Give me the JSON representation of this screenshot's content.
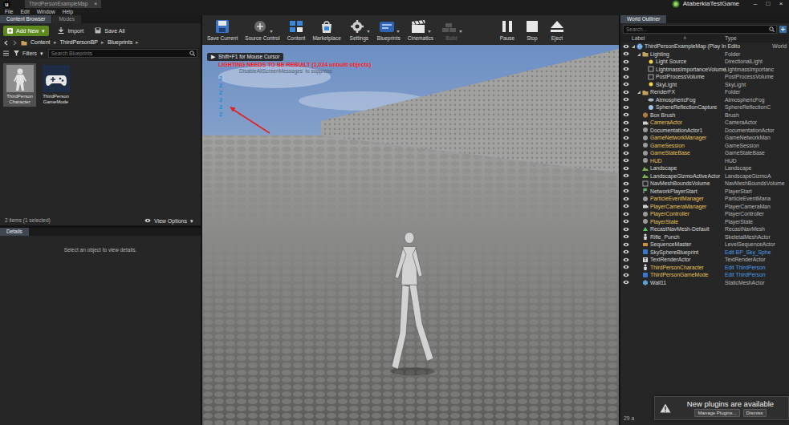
{
  "titlebar": {
    "logo": "u",
    "tab": {
      "label": "ThirdPersonExampleMap",
      "close": "×"
    },
    "project": "AtaberkiaTestGame",
    "controls": [
      "–",
      "□",
      "×"
    ]
  },
  "menu": [
    "File",
    "Edit",
    "Window",
    "Help"
  ],
  "content_browser": {
    "tabs": [
      {
        "label": "Content Browser",
        "selected": true
      },
      {
        "label": "Modes",
        "selected": false
      }
    ],
    "add_new": {
      "label": "Add New",
      "caret": "▾"
    },
    "import": "Import",
    "save_all": "Save All",
    "path": [
      "Content",
      "ThirdPersonBP",
      "Blueprints"
    ],
    "separator": "▸",
    "filters": {
      "label": "Filters",
      "caret": "▾"
    },
    "search": {
      "placeholder": "Search Blueprints"
    },
    "assets": [
      {
        "name": "ThirdPerson Character",
        "kind": "character",
        "selected": true
      },
      {
        "name": "ThirdPerson GameMode",
        "kind": "gamemode",
        "selected": false
      }
    ],
    "count": "2 items (1 selected)",
    "view_options": {
      "label": "View Options",
      "caret": "▾"
    }
  },
  "details": {
    "tab": {
      "label": "Details",
      "selected": true
    },
    "empty": "Select an object to view details."
  },
  "toolbar": [
    {
      "label": "Save Current",
      "kind": "save",
      "has_menu": false,
      "disabled": false
    },
    {
      "label": "Source Control",
      "kind": "source",
      "has_menu": true,
      "disabled": false
    },
    {
      "label": "Content",
      "kind": "content",
      "has_menu": false,
      "disabled": false
    },
    {
      "label": "Marketplace",
      "kind": "market",
      "has_menu": false,
      "disabled": false
    },
    {
      "label": "Settings",
      "kind": "settings",
      "has_menu": true,
      "disabled": false
    },
    {
      "label": "Blueprints",
      "kind": "blueprints",
      "has_menu": true,
      "disabled": false
    },
    {
      "label": "Cinematics",
      "kind": "cinematics",
      "has_menu": true,
      "disabled": false
    },
    {
      "label": "Build",
      "kind": "build",
      "has_menu": true,
      "disabled": true
    },
    {
      "label": "Pause",
      "kind": "pause",
      "has_menu": false,
      "disabled": false
    },
    {
      "label": "Stop",
      "kind": "stop",
      "has_menu": false,
      "disabled": false
    },
    {
      "label": "Eject",
      "kind": "eject",
      "has_menu": false,
      "disabled": false
    }
  ],
  "viewport": {
    "hint_icon": "▶",
    "hint": "Shift+F1 for Mouse Cursor",
    "warning": "LIGHTING NEEDS TO BE REBUILT (1,024 unbuilt objects)",
    "suppress": "DisableAllScreenMessages' to suppress",
    "messages": [
      "2",
      "2",
      "2",
      "2",
      "2",
      "2"
    ]
  },
  "outliner": {
    "tab": {
      "label": "World Outliner",
      "selected": true
    },
    "search": {
      "placeholder": "Search..."
    },
    "columns": {
      "label": "Label",
      "sort_icon": "˄",
      "type": "Type"
    },
    "rows": [
      {
        "label": "ThirdPersonExampleMap (Play In Edito",
        "type": "World",
        "depth": 0,
        "kind": "world",
        "expanded": true,
        "visible": true,
        "color": "#d8d8d8",
        "type_color": "#b8b8b8"
      },
      {
        "label": "Lighting",
        "type": "Folder",
        "depth": 1,
        "kind": "folder",
        "expanded": true,
        "visible": true,
        "color": "#d8d8d8",
        "type_color": "#b8b8b8"
      },
      {
        "label": "Light Source",
        "type": "DirectionalLight",
        "depth": 2,
        "kind": "light",
        "visible": true,
        "color": "#d8d8d8",
        "type_color": "#b8b8b8"
      },
      {
        "label": "LightmassImportanceVolume",
        "type": "LightmassImportanc",
        "depth": 2,
        "kind": "volume",
        "visible": true,
        "color": "#d8d8d8",
        "type_color": "#b8b8b8"
      },
      {
        "label": "PostProcessVolume",
        "type": "PostProcessVolume",
        "depth": 2,
        "kind": "volume",
        "visible": true,
        "color": "#d8d8d8",
        "type_color": "#b8b8b8"
      },
      {
        "label": "SkyLight",
        "type": "SkyLight",
        "depth": 2,
        "kind": "light",
        "visible": true,
        "color": "#d8d8d8",
        "type_color": "#b8b8b8"
      },
      {
        "label": "RenderFX",
        "type": "Folder",
        "depth": 1,
        "kind": "folder",
        "expanded": true,
        "visible": true,
        "color": "#d8d8d8",
        "type_color": "#b8b8b8"
      },
      {
        "label": "AtmosphericFog",
        "type": "AtmosphericFog",
        "depth": 2,
        "kind": "fog",
        "visible": true,
        "color": "#d8d8d8",
        "type_color": "#b8b8b8"
      },
      {
        "label": "SphereReflectionCapture",
        "type": "SphereReflectionC",
        "depth": 2,
        "kind": "capture",
        "visible": true,
        "color": "#d8d8d8",
        "type_color": "#b8b8b8"
      },
      {
        "label": "Box Brush",
        "type": "Brush",
        "depth": 1,
        "kind": "brush",
        "visible": true,
        "color": "#d8d8d8",
        "type_color": "#b8b8b8"
      },
      {
        "label": "CameraActor",
        "type": "CameraActor",
        "depth": 1,
        "kind": "camera",
        "visible": true,
        "color": "#e7c15e",
        "type_color": "#b8b8b8"
      },
      {
        "label": "DocumentationActor1",
        "type": "DocumentationActor",
        "depth": 1,
        "kind": "info",
        "visible": true,
        "color": "#d8d8d8",
        "type_color": "#b8b8b8"
      },
      {
        "label": "GameNetworkManager",
        "type": "GameNetworkMan",
        "depth": 1,
        "kind": "info",
        "visible": true,
        "color": "#e7c15e",
        "type_color": "#b8b8b8"
      },
      {
        "label": "GameSession",
        "type": "GameSession",
        "depth": 1,
        "kind": "info",
        "visible": true,
        "color": "#e7c15e",
        "type_color": "#b8b8b8"
      },
      {
        "label": "GameStateBase",
        "type": "GameStateBase",
        "depth": 1,
        "kind": "info",
        "visible": true,
        "color": "#e7c15e",
        "type_color": "#b8b8b8"
      },
      {
        "label": "HUD",
        "type": "HUD",
        "depth": 1,
        "kind": "info",
        "visible": true,
        "color": "#e7c15e",
        "type_color": "#b8b8b8"
      },
      {
        "label": "Landscape",
        "type": "Landscape",
        "depth": 1,
        "kind": "landscape",
        "visible": true,
        "color": "#d8d8d8",
        "type_color": "#b8b8b8"
      },
      {
        "label": "LandscapeGizmoActiveActor",
        "type": "LandscapeGizmoA",
        "depth": 1,
        "kind": "landscape",
        "visible": true,
        "color": "#d8d8d8",
        "type_color": "#b8b8b8"
      },
      {
        "label": "NavMeshBoundsVolume",
        "type": "NavMeshBoundsVolume",
        "depth": 1,
        "kind": "volume",
        "visible": true,
        "color": "#d8d8d8",
        "type_color": "#b8b8b8"
      },
      {
        "label": "NetworkPlayerStart",
        "type": "PlayerStart",
        "depth": 1,
        "kind": "start",
        "visible": true,
        "color": "#d8d8d8",
        "type_color": "#b8b8b8"
      },
      {
        "label": "ParticleEventManager",
        "type": "ParticleEventMana",
        "depth": 1,
        "kind": "info",
        "visible": true,
        "color": "#e7c15e",
        "type_color": "#b8b8b8"
      },
      {
        "label": "PlayerCameraManager",
        "type": "PlayerCameraMan",
        "depth": 1,
        "kind": "camera",
        "visible": true,
        "color": "#e7c15e",
        "type_color": "#b8b8b8"
      },
      {
        "label": "PlayerController",
        "type": "PlayerController",
        "depth": 1,
        "kind": "info",
        "visible": true,
        "color": "#e7c15e",
        "type_color": "#b8b8b8"
      },
      {
        "label": "PlayerState",
        "type": "PlayerState",
        "depth": 1,
        "kind": "info",
        "visible": true,
        "color": "#e7c15e",
        "type_color": "#b8b8b8"
      },
      {
        "label": "RecastNavMesh-Default",
        "type": "RecastNavMesh",
        "depth": 1,
        "kind": "nav",
        "visible": true,
        "color": "#d8d8d8",
        "type_color": "#b8b8b8"
      },
      {
        "label": "Rifle_Punch",
        "type": "SkeletalMeshActor",
        "depth": 1,
        "kind": "pawn",
        "visible": true,
        "color": "#d8d8d8",
        "type_color": "#b8b8b8"
      },
      {
        "label": "SequenceMaster",
        "type": "LevelSequenceActor",
        "depth": 1,
        "kind": "sequence",
        "visible": true,
        "color": "#d8d8d8",
        "type_color": "#b8b8b8"
      },
      {
        "label": "SkySphereBlueprint",
        "type": "Edit BP_Sky_Sphe",
        "depth": 1,
        "kind": "blueprint",
        "visible": true,
        "color": "#d8d8d8",
        "type_color": "#4d9de6"
      },
      {
        "label": "TextRenderActor",
        "type": "TextRenderActor",
        "depth": 1,
        "kind": "text",
        "visible": true,
        "color": "#d8d8d8",
        "type_color": "#b8b8b8"
      },
      {
        "label": "ThirdPersonCharacter",
        "type": "Edit ThirdPerson",
        "depth": 1,
        "kind": "pawn",
        "visible": true,
        "color": "#e7c15e",
        "type_color": "#4d9de6"
      },
      {
        "label": "ThirdPersonGameMode",
        "type": "Edit ThirdPerson",
        "depth": 1,
        "kind": "blueprint",
        "visible": true,
        "color": "#e7c15e",
        "type_color": "#4d9de6"
      },
      {
        "label": "Wall11",
        "type": "StaticMeshActor",
        "depth": 1,
        "kind": "mesh",
        "visible": true,
        "color": "#d8d8d8",
        "type_color": "#b8b8b8"
      }
    ],
    "status": "29 a"
  },
  "notification": {
    "title": "New plugins are available",
    "buttons": [
      "Manage Plugins...",
      "Dismiss"
    ]
  }
}
